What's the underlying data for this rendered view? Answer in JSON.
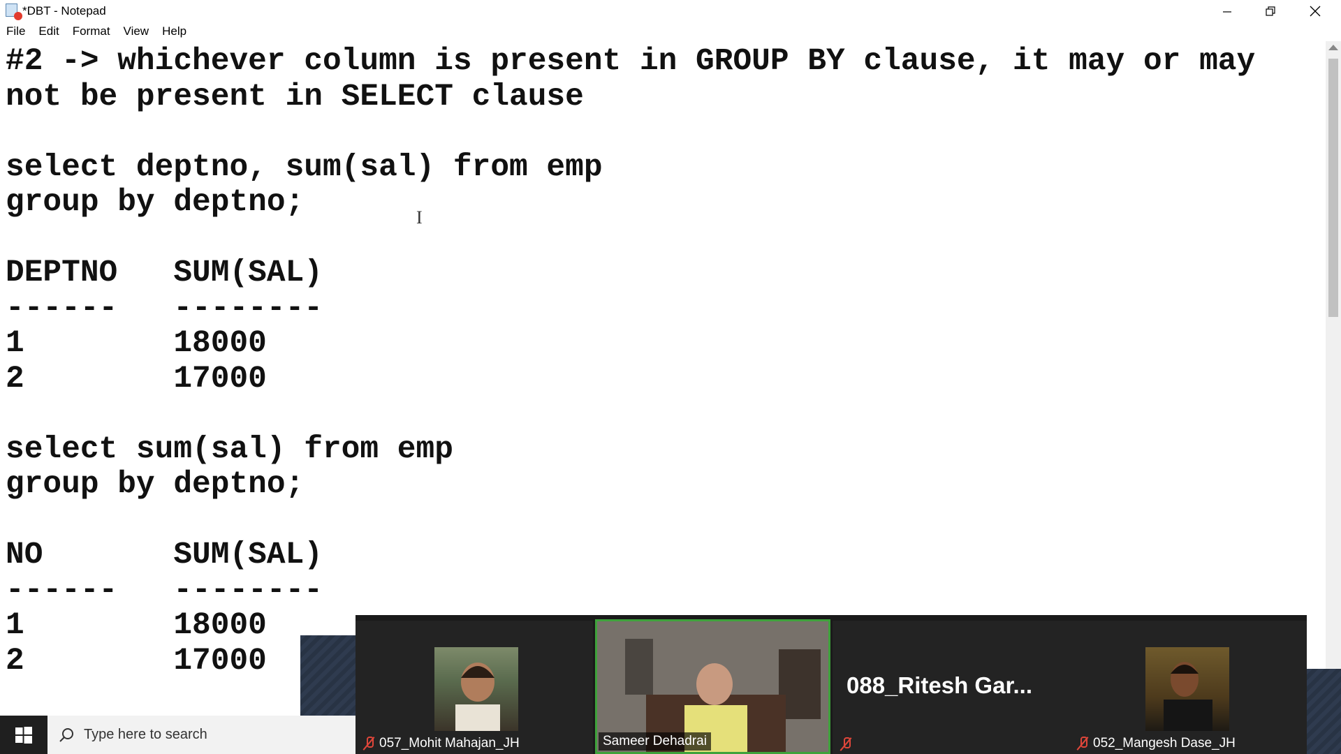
{
  "window": {
    "title": "*DBT - Notepad",
    "icon": "notepad-icon",
    "controls": [
      "minimize-icon",
      "restore-icon",
      "close-icon"
    ]
  },
  "menu": {
    "items": [
      "File",
      "Edit",
      "Format",
      "View",
      "Help"
    ]
  },
  "editor": {
    "content": "#2 -> whichever column is present in GROUP BY clause, it may or may\nnot be present in SELECT clause\n\nselect deptno, sum(sal) from emp\ngroup by deptno;\n\nDEPTNO   SUM(SAL)\n------   --------\n1        18000\n2        17000\n\nselect sum(sal) from emp\ngroup by deptno;\n\nNO       SUM(SAL)\n------   --------\n1        18000\n2        17000"
  },
  "meeting": {
    "participants": [
      {
        "name": "057_Mohit Mahajan_JH",
        "muted": true
      },
      {
        "name": "Sameer Dehadrai",
        "muted": false,
        "active_speaker": true
      },
      {
        "name": "088_Ritesh  Gar...",
        "muted": true
      },
      {
        "name": "052_Mangesh Dase_JH",
        "muted": true
      }
    ]
  },
  "taskbar": {
    "search_placeholder": "Type here to search"
  },
  "colors": {
    "active_speaker_border": "#3ea23b",
    "muted_mic": "#e0463a",
    "panel_bg": "#1a1a1a"
  }
}
